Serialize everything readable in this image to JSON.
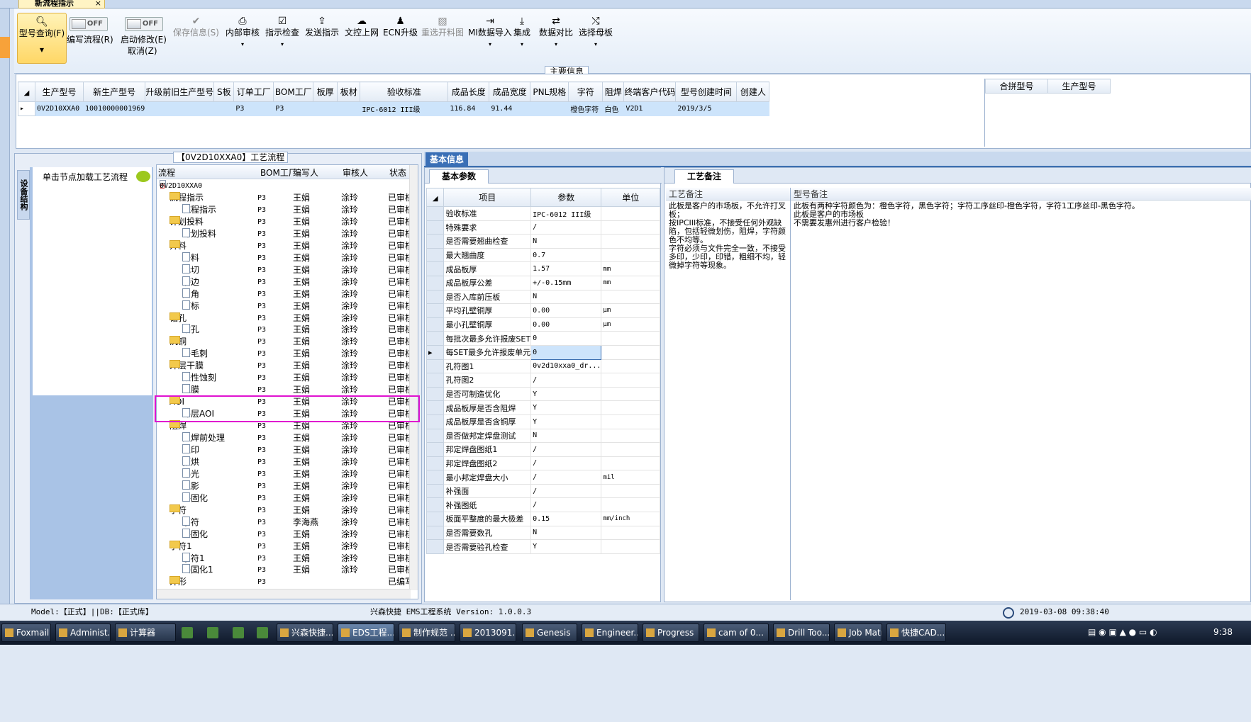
{
  "tab": {
    "title": "新流程指示",
    "close": "×"
  },
  "ribbon": {
    "primary": {
      "label": "型号查询(F)",
      "icon": "search-icon"
    },
    "edit_flow": {
      "state": "OFF",
      "label": "编写流程(R)"
    },
    "enable_modify": {
      "state": "OFF",
      "label": "启动修改(E)",
      "sub": "取消(Z)"
    },
    "buttons": [
      {
        "label": "保存信息(S)",
        "icon": "check-icon",
        "disabled": true
      },
      {
        "label": "内部审核",
        "icon": "print-icon"
      },
      {
        "label": "指示检查",
        "icon": "checkbox-icon"
      },
      {
        "label": "发送指示",
        "icon": "upload-icon"
      },
      {
        "label": "文控上网",
        "icon": "cloud-icon"
      },
      {
        "label": "ECN升级",
        "icon": "people-icon"
      },
      {
        "label": "重选开料图",
        "icon": "image-icon",
        "disabled": true
      },
      {
        "label": "MI数据导入",
        "icon": "import-icon"
      },
      {
        "label": "集成",
        "icon": "download-icon"
      },
      {
        "label": "数据对比",
        "icon": "compare-icon"
      },
      {
        "label": "选择母板",
        "icon": "shuffle-icon"
      }
    ]
  },
  "main": {
    "caption": "主要信息",
    "columns": [
      "生产型号",
      "新生产型号",
      "升级前旧生产型号",
      "S板",
      "订单工厂",
      "BOM工厂",
      "板厚",
      "板材",
      "验收标准",
      "成品长度",
      "成品宽度",
      "PNL规格",
      "字符",
      "阻焊",
      "终端客户代码",
      "型号创建时间",
      "创建人"
    ],
    "row": [
      "0V2D10XXA0",
      "10010000001969",
      "",
      "",
      "P3",
      "P3",
      "",
      "",
      "IPC-6012 III级",
      "116.84",
      "91.44",
      "",
      "橙色字符",
      "白色",
      "V2D1",
      "2019/3/5",
      ""
    ],
    "right_columns": [
      "合拼型号",
      "生产型号"
    ]
  },
  "flow": {
    "caption": "【0V2D10XXA0】工艺流程",
    "side_tab": "设备结构",
    "hint": "单击节点加载工艺流程",
    "headers": [
      "流程",
      "BOM工厂",
      "编写人",
      "审核人",
      "状态"
    ],
    "root": "0V2D10XXA0",
    "rows": [
      {
        "name": "流程指示",
        "level": 1,
        "bom": "P3",
        "writer": "王娟",
        "auditor": "涂玲",
        "status": "已审核"
      },
      {
        "name": "流程指示",
        "level": 2,
        "bom": "P3",
        "writer": "王娟",
        "auditor": "涂玲",
        "status": "已审核"
      },
      {
        "name": "计划投料",
        "level": 1,
        "bom": "P3",
        "writer": "王娟",
        "auditor": "涂玲",
        "status": "已审核"
      },
      {
        "name": "计划投料",
        "level": 2,
        "bom": "P3",
        "writer": "王娟",
        "auditor": "涂玲",
        "status": "已审核"
      },
      {
        "name": "开料",
        "level": 1,
        "bom": "P3",
        "writer": "王娟",
        "auditor": "涂玲",
        "status": "已审核"
      },
      {
        "name": "开料",
        "level": 2,
        "bom": "P3",
        "writer": "王娟",
        "auditor": "涂玲",
        "status": "已审核"
      },
      {
        "name": "裁切",
        "level": 2,
        "bom": "P3",
        "writer": "王娟",
        "auditor": "涂玲",
        "status": "已审核"
      },
      {
        "name": "磨边",
        "level": 2,
        "bom": "P3",
        "writer": "王娟",
        "auditor": "涂玲",
        "status": "已审核"
      },
      {
        "name": "圆角",
        "level": 2,
        "bom": "P3",
        "writer": "王娟",
        "auditor": "涂玲",
        "status": "已审核"
      },
      {
        "name": "打标",
        "level": 2,
        "bom": "P3",
        "writer": "王娟",
        "auditor": "涂玲",
        "status": "已审核"
      },
      {
        "name": "钻孔",
        "level": 1,
        "bom": "P3",
        "writer": "王娟",
        "auditor": "涂玲",
        "status": "已审核"
      },
      {
        "name": "钻孔",
        "level": 2,
        "bom": "P3",
        "writer": "王娟",
        "auditor": "涂玲",
        "status": "已审核"
      },
      {
        "name": "沉铜",
        "level": 1,
        "bom": "P3",
        "writer": "王娟",
        "auditor": "涂玲",
        "status": "已审核"
      },
      {
        "name": "去毛刺",
        "level": 2,
        "bom": "P3",
        "writer": "王娟",
        "auditor": "涂玲",
        "status": "已审核"
      },
      {
        "name": "外层干膜",
        "level": 1,
        "bom": "P3",
        "writer": "王娟",
        "auditor": "涂玲",
        "status": "已审核"
      },
      {
        "name": "酸性蚀刻",
        "level": 2,
        "bom": "P3",
        "writer": "王娟",
        "auditor": "涂玲",
        "status": "已审核"
      },
      {
        "name": "退膜",
        "level": 2,
        "bom": "P3",
        "writer": "王娟",
        "auditor": "涂玲",
        "status": "已审核"
      },
      {
        "name": "AOI",
        "level": 1,
        "bom": "P3",
        "writer": "王娟",
        "auditor": "涂玲",
        "status": "已审核"
      },
      {
        "name": "外层AOI",
        "level": 2,
        "bom": "P3",
        "writer": "王娟",
        "auditor": "涂玲",
        "status": "已审核"
      },
      {
        "name": "阻焊",
        "level": 1,
        "bom": "P3",
        "writer": "王娟",
        "auditor": "涂玲",
        "status": "已审核"
      },
      {
        "name": "阻焊前处理",
        "level": 2,
        "bom": "P3",
        "writer": "王娟",
        "auditor": "涂玲",
        "status": "已审核"
      },
      {
        "name": "丝印",
        "level": 2,
        "bom": "P3",
        "writer": "王娟",
        "auditor": "涂玲",
        "status": "已审核"
      },
      {
        "name": "预烘",
        "level": 2,
        "bom": "P3",
        "writer": "王娟",
        "auditor": "涂玲",
        "status": "已审核"
      },
      {
        "name": "曝光",
        "level": 2,
        "bom": "P3",
        "writer": "王娟",
        "auditor": "涂玲",
        "status": "已审核"
      },
      {
        "name": "显影",
        "level": 2,
        "bom": "P3",
        "writer": "王娟",
        "auditor": "涂玲",
        "status": "已审核"
      },
      {
        "name": "终固化",
        "level": 2,
        "bom": "P3",
        "writer": "王娟",
        "auditor": "涂玲",
        "status": "已审核"
      },
      {
        "name": "字符",
        "level": 1,
        "bom": "P3",
        "writer": "王娟",
        "auditor": "涂玲",
        "status": "已审核"
      },
      {
        "name": "字符",
        "level": 2,
        "bom": "P3",
        "writer": "李海燕",
        "auditor": "涂玲",
        "status": "已审核"
      },
      {
        "name": "终固化",
        "level": 2,
        "bom": "P3",
        "writer": "王娟",
        "auditor": "涂玲",
        "status": "已审核"
      },
      {
        "name": "字符1",
        "level": 1,
        "bom": "P3",
        "writer": "王娟",
        "auditor": "涂玲",
        "status": "已审核"
      },
      {
        "name": "字符1",
        "level": 2,
        "bom": "P3",
        "writer": "王娟",
        "auditor": "涂玲",
        "status": "已审核"
      },
      {
        "name": "终固化1",
        "level": 2,
        "bom": "P3",
        "writer": "王娟",
        "auditor": "涂玲",
        "status": "已审核"
      },
      {
        "name": "外形",
        "level": 1,
        "bom": "P3",
        "writer": "",
        "auditor": "",
        "status": "已编写"
      }
    ]
  },
  "basic": {
    "header_tab": "基本信息",
    "param_tab": "基本参数",
    "columns": [
      "项目",
      "参数",
      "单位"
    ],
    "rows": [
      {
        "k": "验收标准",
        "v": "IPC-6012 III级",
        "u": ""
      },
      {
        "k": "特殊要求",
        "v": "/",
        "u": ""
      },
      {
        "k": "是否需要翘曲检查",
        "v": "N",
        "u": ""
      },
      {
        "k": "最大翘曲度",
        "v": "0.7",
        "u": ""
      },
      {
        "k": "成品板厚",
        "v": "1.57",
        "u": "mm"
      },
      {
        "k": "成品板厚公差",
        "v": "+/-0.15mm",
        "u": "mm"
      },
      {
        "k": "是否入库前压板",
        "v": "N",
        "u": ""
      },
      {
        "k": "平均孔壁铜厚",
        "v": "0.00",
        "u": "μm"
      },
      {
        "k": "最小孔壁铜厚",
        "v": "0.00",
        "u": "μm"
      },
      {
        "k": "每批次最多允许报废SET",
        "v": "0",
        "u": ""
      },
      {
        "k": "每SET最多允许报废单元",
        "v": "0",
        "u": ""
      },
      {
        "k": "孔符图1",
        "v": "0v2d10xxa0_dr...",
        "u": ""
      },
      {
        "k": "孔符图2",
        "v": "/",
        "u": ""
      },
      {
        "k": "是否可制造优化",
        "v": "Y",
        "u": ""
      },
      {
        "k": "成品板厚是否含阻焊",
        "v": "Y",
        "u": ""
      },
      {
        "k": "成品板厚是否含铜厚",
        "v": "Y",
        "u": ""
      },
      {
        "k": "是否做邦定焊盘测试",
        "v": "N",
        "u": ""
      },
      {
        "k": "邦定焊盘图纸1",
        "v": "/",
        "u": ""
      },
      {
        "k": "邦定焊盘图纸2",
        "v": "/",
        "u": ""
      },
      {
        "k": "最小邦定焊盘大小",
        "v": "/",
        "u": "mil"
      },
      {
        "k": "补强面",
        "v": "/",
        "u": ""
      },
      {
        "k": "补强图纸",
        "v": "/",
        "u": ""
      },
      {
        "k": "板面平整度的最大极差",
        "v": "0.15",
        "u": "mm/inch"
      },
      {
        "k": "是否需要数孔",
        "v": "N",
        "u": ""
      },
      {
        "k": "是否需要验孔检查",
        "v": "Y",
        "u": ""
      }
    ]
  },
  "notes": {
    "tab": "工艺备注",
    "col1": "工艺备注",
    "col2": "型号备注",
    "text1": "此板是客户的市场板，不允许打叉板；\n按IPCIII标准，不接受任何外观缺陷，包括轻微划伤，阻焊，字符颜色不均等。\n字符必须与文件完全一致，不接受多印，少印，印错，粗细不均，轻微掉字符等现象。",
    "text2": "此板有两种字符颜色为：橙色字符，黑色字符；字符工序丝印-橙色字符，字符1工序丝印-黑色字符。\n此板是客户的市场板\n不需要发惠州进行客户检验！"
  },
  "status": {
    "model": "Model:【正式】||DB:【正式库】",
    "system": "兴森快捷 EMS工程系统 Version: 1.0.0.3",
    "datetime": "2019-03-08 09:38:40"
  },
  "taskbar": {
    "items": [
      "Foxmail",
      "Administ...",
      "计算器",
      "兴森快捷...",
      "EDS工程...",
      "制作规范 ...",
      "2013091...",
      "Genesis",
      "Engineer...",
      "Progress",
      "cam of 0...",
      "Drill Too...",
      "Job Matr...",
      "快捷CAD..."
    ],
    "clock": "9:38"
  }
}
